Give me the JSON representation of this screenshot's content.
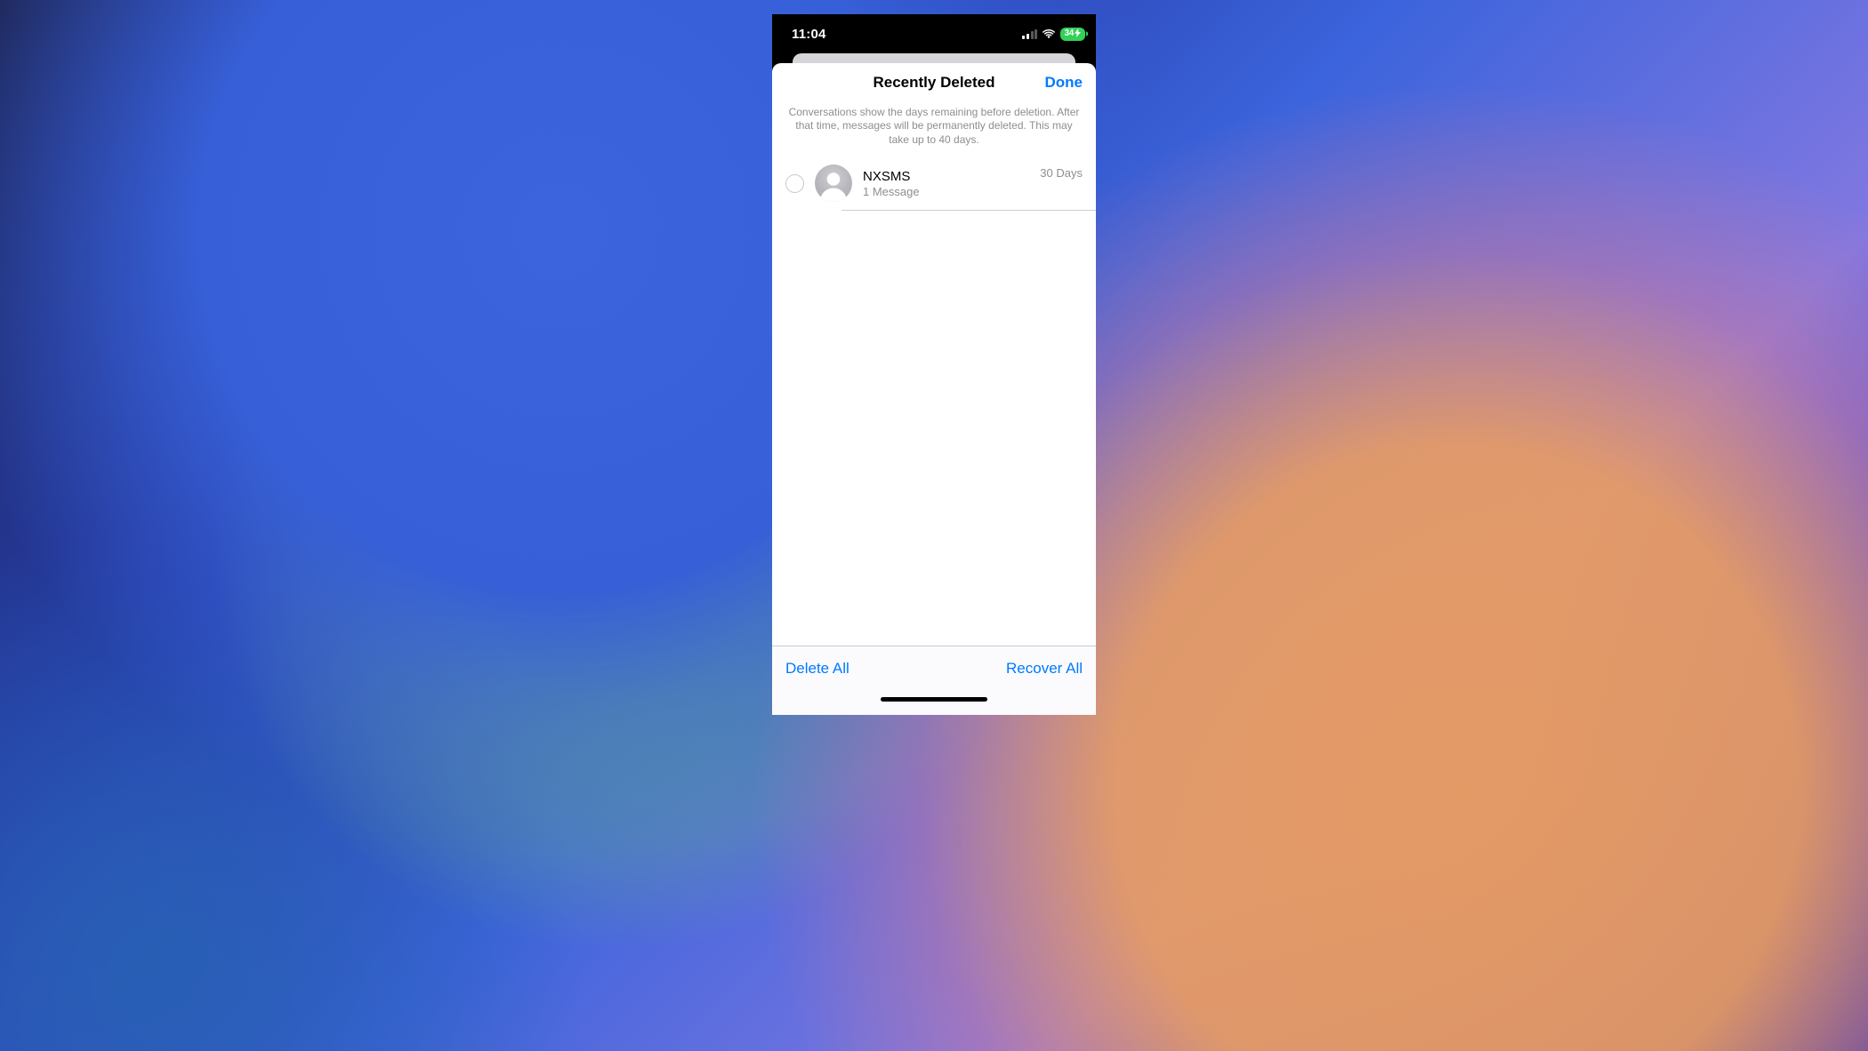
{
  "status_bar": {
    "time": "11:04",
    "battery_percent": "34",
    "cellular_bars_active": 2,
    "charging": true
  },
  "sheet": {
    "title": "Recently Deleted",
    "done_label": "Done",
    "description": "Conversations show the days remaining before deletion. After that time, messages will be permanently deleted. This may take up to 40 days."
  },
  "conversations": [
    {
      "name": "NXSMS",
      "subtitle": "1 Message",
      "days_remaining": "30 Days",
      "selected": false
    }
  ],
  "toolbar": {
    "delete_all_label": "Delete All",
    "recover_all_label": "Recover All"
  },
  "colors": {
    "ios_blue": "#007aff",
    "ios_green": "#32d158",
    "secondary_label": "#8e8e93"
  }
}
